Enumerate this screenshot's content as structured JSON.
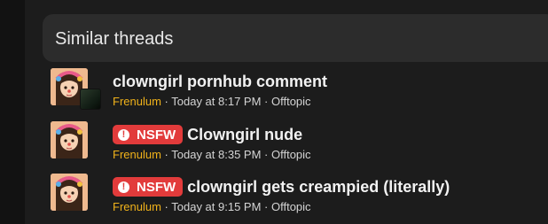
{
  "section": {
    "title": "Similar threads"
  },
  "threads": [
    {
      "title": "clowngirl pornhub comment",
      "prefix": "",
      "author": "Frenulum",
      "sep1": " · ",
      "date": "Today at 8:17 PM",
      "sep2": " · ",
      "forum": "Offtopic"
    },
    {
      "title": "Clowngirl nude",
      "prefix": "NSFW",
      "prefix_icon": "!",
      "author": "Frenulum",
      "sep1": " · ",
      "date": "Today at 8:35 PM",
      "sep2": " · ",
      "forum": "Offtopic"
    },
    {
      "title": "clowngirl gets creampied (literally)",
      "prefix": "NSFW",
      "prefix_icon": "!",
      "author": "Frenulum",
      "sep1": " · ",
      "date": "Today at 9:15 PM",
      "sep2": " · ",
      "forum": "Offtopic"
    }
  ],
  "colors": {
    "author": "#f0b21a",
    "nsfw_badge": "#e23b3b",
    "panel_header": "#2c2c2c"
  },
  "icons": {
    "prefix_icon": "exclamation-circle-icon"
  }
}
